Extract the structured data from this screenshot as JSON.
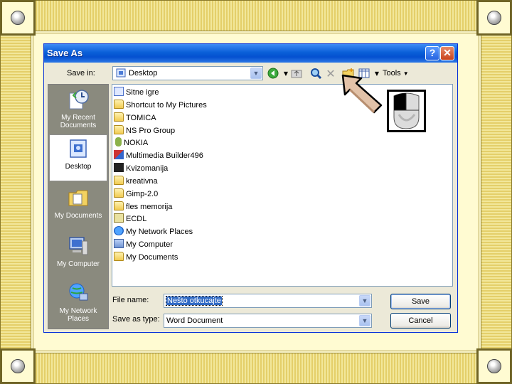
{
  "dialog": {
    "title": "Save As",
    "help_label": "?",
    "close_label": "✕"
  },
  "toolbar": {
    "save_in_label": "Save in:",
    "save_in_value": "Desktop",
    "tools_label": "Tools",
    "icons": [
      "back-icon",
      "dropdown-arrow-icon",
      "up-folder-icon",
      "search-web-icon",
      "delete-icon",
      "new-folder-icon",
      "views-icon"
    ]
  },
  "places": [
    {
      "label": "My Recent Documents",
      "icon": "recent-documents-icon",
      "selected": false
    },
    {
      "label": "Desktop",
      "icon": "desktop-icon",
      "selected": true
    },
    {
      "label": "My Documents",
      "icon": "my-documents-icon",
      "selected": false
    },
    {
      "label": "My Computer",
      "icon": "my-computer-icon",
      "selected": false
    },
    {
      "label": "My Network Places",
      "icon": "network-places-icon",
      "selected": false
    }
  ],
  "files": [
    {
      "name": "Sitne igre",
      "icon": "shortcut"
    },
    {
      "name": "Shortcut to My Pictures",
      "icon": "folder"
    },
    {
      "name": "TOMICA",
      "icon": "folder"
    },
    {
      "name": "NS Pro Group",
      "icon": "folder"
    },
    {
      "name": "NOKIA",
      "icon": "nokia"
    },
    {
      "name": "Multimedia Builder496",
      "icon": "app"
    },
    {
      "name": "Kvizomanija",
      "icon": "dark"
    },
    {
      "name": "kreativna",
      "icon": "folder"
    },
    {
      "name": "Gimp-2.0",
      "icon": "folder"
    },
    {
      "name": "fles memorija",
      "icon": "folder"
    },
    {
      "name": "ECDL",
      "icon": "doc"
    },
    {
      "name": "My Network Places",
      "icon": "net"
    },
    {
      "name": "My Computer",
      "icon": "pc"
    },
    {
      "name": "My Documents",
      "icon": "folder"
    }
  ],
  "form": {
    "file_name_label": "File name:",
    "file_name_value": "Nešto otkucajte",
    "save_as_type_label": "Save as type:",
    "save_as_type_value": "Word Document",
    "save_button": "Save",
    "cancel_button": "Cancel"
  },
  "colors": {
    "titlebar": "#0a5fd8",
    "dialog_bg": "#ece9d8",
    "slide_bg": "#fffbd2"
  }
}
